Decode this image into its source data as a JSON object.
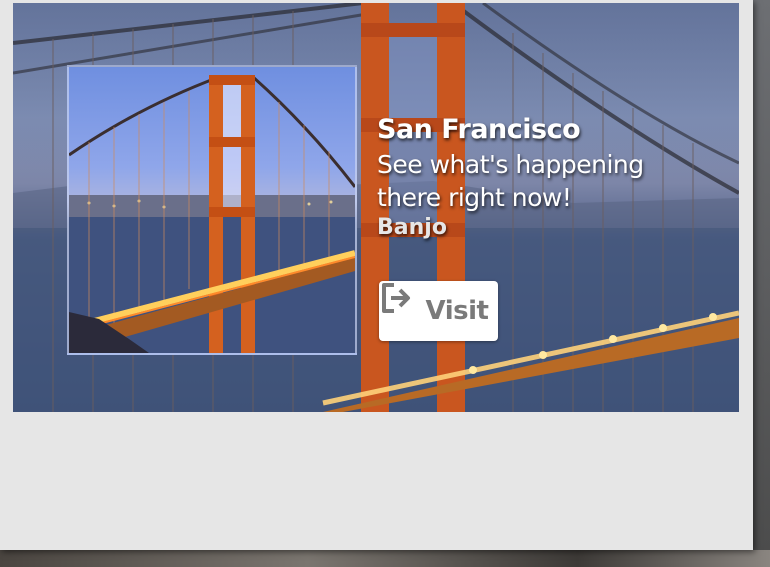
{
  "card": {
    "title": "San Francisco",
    "subtitle_line1": "See what's happening",
    "subtitle_line2": "there right now!",
    "source": "Banjo",
    "visit_label": "Visit",
    "visit_icon": "exit-arrow-icon",
    "hero_image": "golden-gate-bridge-night-photo",
    "thumbnail_image": "golden-gate-bridge-tower-photo"
  },
  "colors": {
    "card_background": "#e6e6e6",
    "button_background": "#ffffff",
    "button_text": "#7a7a7a",
    "text": "#ffffff"
  }
}
